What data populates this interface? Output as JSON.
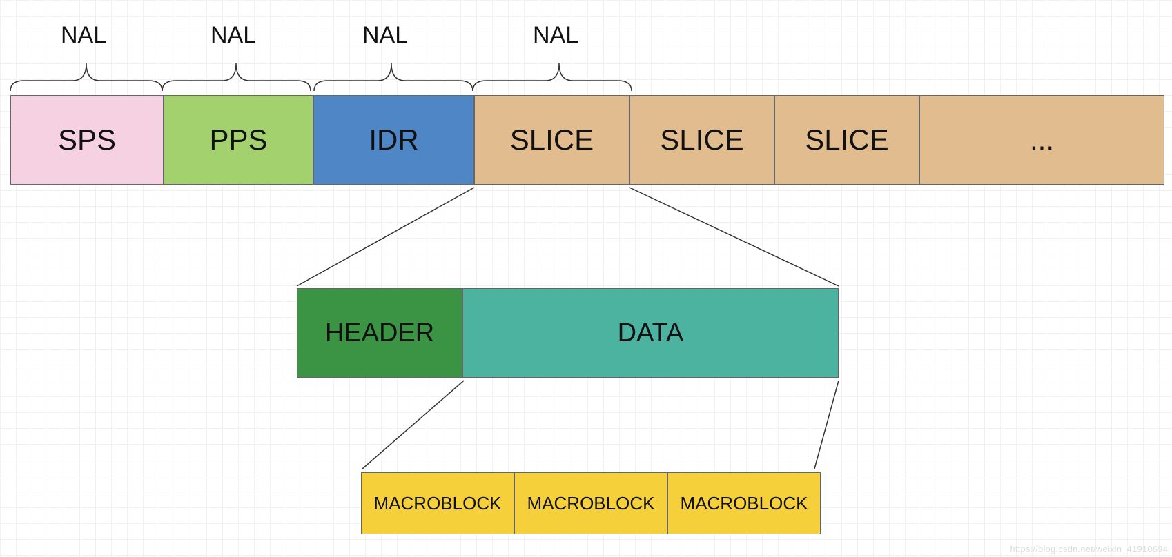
{
  "nal_labels": [
    "NAL",
    "NAL",
    "NAL",
    "NAL"
  ],
  "row1": {
    "sps": {
      "label": "SPS"
    },
    "pps": {
      "label": "PPS"
    },
    "idr": {
      "label": "IDR"
    },
    "slice1": {
      "label": "SLICE"
    },
    "slice2": {
      "label": "SLICE"
    },
    "slice3": {
      "label": "SLICE"
    },
    "more": {
      "label": "..."
    }
  },
  "row2": {
    "header": {
      "label": "HEADER"
    },
    "data": {
      "label": "DATA"
    }
  },
  "row3": {
    "mb1": {
      "label": "MACROBLOCK"
    },
    "mb2": {
      "label": "MACROBLOCK"
    },
    "mb3": {
      "label": "MACROBLOCK"
    }
  },
  "colors": {
    "sps": "#f6d1e1",
    "pps": "#a3d16e",
    "idr": "#4f86c6",
    "slice": "#e1bc8f",
    "header": "#3a9444",
    "data": "#4cb3a0",
    "macroblock": "#f6d03b"
  },
  "watermark": "https://blog.csdn.net/weixin_41910694"
}
